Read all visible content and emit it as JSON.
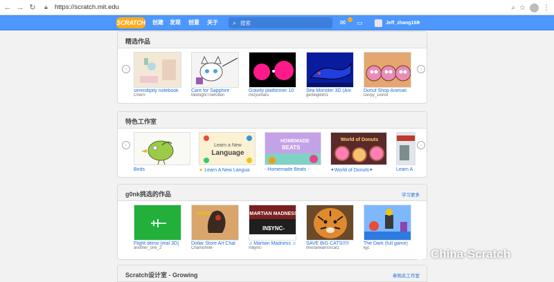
{
  "browser": {
    "url": "https://scratch.mit.edu"
  },
  "nav": {
    "logo": "SCRATCH",
    "links": [
      "创建",
      "发现",
      "创意",
      "关于"
    ],
    "search_placeholder": "搜索",
    "username": "Jeff_zhang168"
  },
  "featured_projects": {
    "title": "精选作品",
    "items": [
      {
        "title": "serendipity notebook",
        "author": "Cherri-"
      },
      {
        "title": "Care for Sapphire",
        "author": "MidnightTheKitten"
      },
      {
        "title": "Gravity platformer 10",
        "author": "mizyumaru"
      },
      {
        "title": "Sea Monster 3D (Ani",
        "author": "gerbilgibit01"
      },
      {
        "title": "Donut Shop Animati",
        "author": "Derpy_Donut"
      }
    ]
  },
  "featured_studios": {
    "title": "特色工作室",
    "items": [
      {
        "title": "Birds"
      },
      {
        "title": "Learn A New Langua"
      },
      {
        "title": "- Homemade Beats -"
      },
      {
        "title": "✦World of Donuts✦"
      },
      {
        "title": "Learn A"
      }
    ]
  },
  "curator_picks": {
    "title": "g0nk挑选的作品",
    "more": "学习更多",
    "items": [
      {
        "title": "Flight demo [real 3D]",
        "author": "another_one_2"
      },
      {
        "title": "Dollar Store Art Chal",
        "author": "Chamomile-"
      },
      {
        "title": "♫ Martian Madness ♫",
        "author": "In$ync-"
      },
      {
        "title": "SAVE BIG CATS!!!!!",
        "author": "firestarwarriorcat1"
      },
      {
        "title": "The Dark (full game)",
        "author": "kjjc"
      }
    ]
  },
  "design_studio": {
    "title": "Scratch设计室 - Growing",
    "more": "参观此工作室"
  },
  "watermark": "China-Scratch"
}
